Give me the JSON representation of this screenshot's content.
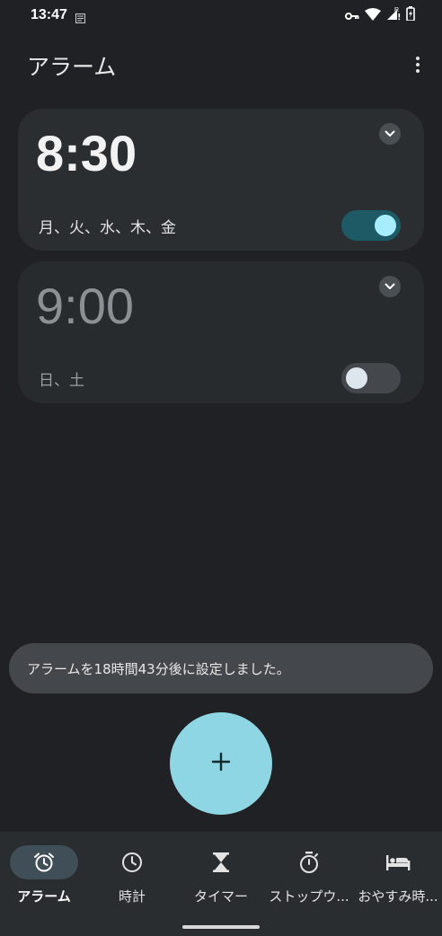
{
  "status_bar": {
    "time": "13:47",
    "icons": [
      "notification-icon",
      "vpn-key-icon",
      "wifi-icon",
      "signal-roaming-icon",
      "battery-charging-icon"
    ]
  },
  "header": {
    "title": "アラーム",
    "menu_icon": "more-vert-icon"
  },
  "alarms": [
    {
      "time": "8:30",
      "days": "月、火、水、木、金",
      "enabled": true,
      "expand_icon": "chevron-down-icon"
    },
    {
      "time": "9:00",
      "days": "日、土",
      "enabled": false,
      "expand_icon": "chevron-down-icon"
    }
  ],
  "snackbar": {
    "text": "アラームを18時間43分後に設定しました。"
  },
  "fab": {
    "icon": "add-icon"
  },
  "bottom_nav": {
    "items": [
      {
        "label": "アラーム",
        "icon": "alarm-clock-icon",
        "active": true
      },
      {
        "label": "時計",
        "icon": "clock-icon",
        "active": false
      },
      {
        "label": "タイマー",
        "icon": "hourglass-icon",
        "active": false
      },
      {
        "label": "ストップウ...",
        "icon": "stopwatch-icon",
        "active": false
      },
      {
        "label": "おやすみ時...",
        "icon": "bed-icon",
        "active": false
      }
    ]
  },
  "colors": {
    "background": "#1f2124",
    "card": "#2a2e31",
    "accent": "#8ed6e3",
    "toggle_on_track": "#1e5a66",
    "toggle_on_knob": "#a6eeff"
  }
}
